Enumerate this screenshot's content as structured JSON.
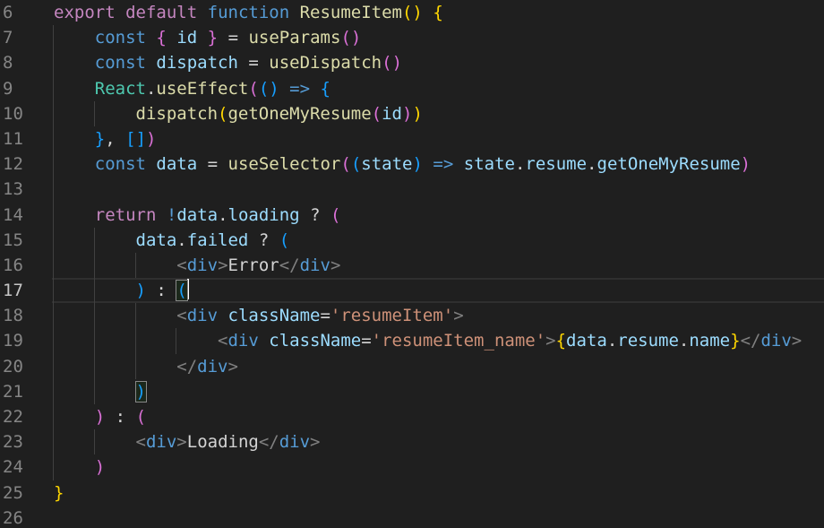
{
  "editor": {
    "background": "#1f1f1f",
    "gutter_color": "#858585",
    "gutter_active_color": "#c6c6c6",
    "guide_color": "#404040",
    "current_line": 17,
    "current_line_border": "#2f2f2f",
    "bracket_match": {
      "border": "#888888",
      "background": "rgba(0,100,0,0.13)"
    },
    "caret_color": "#ffffff",
    "token_colors": {
      "kw1": "#C586C0",
      "kw2": "#569CD6",
      "fn": "#DCDCAA",
      "cls": "#4EC9B0",
      "var": "#9CDCFE",
      "str": "#CE9178",
      "op": "#D4D4D4",
      "txt": "#D4D4D4",
      "tag": "#808080",
      "b1": "#FFD700",
      "b2": "#DA70D6",
      "b3": "#179FFF"
    },
    "lines": [
      {
        "n": 6,
        "guides": [],
        "seg": [
          [
            "kw1",
            "export"
          ],
          [
            "ws",
            " "
          ],
          [
            "kw1",
            "default"
          ],
          [
            "ws",
            " "
          ],
          [
            "kw2",
            "function"
          ],
          [
            "ws",
            " "
          ],
          [
            "fn",
            "ResumeItem"
          ],
          [
            "b1",
            "()"
          ],
          [
            "ws",
            " "
          ],
          [
            "b1",
            "{"
          ]
        ]
      },
      {
        "n": 7,
        "guides": [
          0
        ],
        "seg": [
          [
            "ws",
            "    "
          ],
          [
            "kw2",
            "const"
          ],
          [
            "ws",
            " "
          ],
          [
            "b2",
            "{"
          ],
          [
            "ws",
            " "
          ],
          [
            "var",
            "id"
          ],
          [
            "ws",
            " "
          ],
          [
            "b2",
            "}"
          ],
          [
            "ws",
            " "
          ],
          [
            "op",
            "="
          ],
          [
            "ws",
            " "
          ],
          [
            "fn",
            "useParams"
          ],
          [
            "b2",
            "()"
          ]
        ]
      },
      {
        "n": 8,
        "guides": [
          0
        ],
        "seg": [
          [
            "ws",
            "    "
          ],
          [
            "kw2",
            "const"
          ],
          [
            "ws",
            " "
          ],
          [
            "var",
            "dispatch"
          ],
          [
            "ws",
            " "
          ],
          [
            "op",
            "="
          ],
          [
            "ws",
            " "
          ],
          [
            "fn",
            "useDispatch"
          ],
          [
            "b2",
            "()"
          ]
        ]
      },
      {
        "n": 9,
        "guides": [
          0
        ],
        "seg": [
          [
            "ws",
            "    "
          ],
          [
            "cls",
            "React"
          ],
          [
            "op",
            "."
          ],
          [
            "fn",
            "useEffect"
          ],
          [
            "b2",
            "("
          ],
          [
            "b3",
            "()"
          ],
          [
            "ws",
            " "
          ],
          [
            "kw2",
            "=>"
          ],
          [
            "ws",
            " "
          ],
          [
            "b3",
            "{"
          ]
        ]
      },
      {
        "n": 10,
        "guides": [
          0,
          4
        ],
        "seg": [
          [
            "ws",
            "        "
          ],
          [
            "fn",
            "dispatch"
          ],
          [
            "b1",
            "("
          ],
          [
            "fn",
            "getOneMyResume"
          ],
          [
            "b2",
            "("
          ],
          [
            "var",
            "id"
          ],
          [
            "b2",
            ")"
          ],
          [
            "b1",
            ")"
          ]
        ]
      },
      {
        "n": 11,
        "guides": [
          0
        ],
        "seg": [
          [
            "ws",
            "    "
          ],
          [
            "b3",
            "}"
          ],
          [
            "op",
            ","
          ],
          [
            "ws",
            " "
          ],
          [
            "b3",
            "[]"
          ],
          [
            "b2",
            ")"
          ]
        ]
      },
      {
        "n": 12,
        "guides": [
          0
        ],
        "seg": [
          [
            "ws",
            "    "
          ],
          [
            "kw2",
            "const"
          ],
          [
            "ws",
            " "
          ],
          [
            "var",
            "data"
          ],
          [
            "ws",
            " "
          ],
          [
            "op",
            "="
          ],
          [
            "ws",
            " "
          ],
          [
            "fn",
            "useSelector"
          ],
          [
            "b2",
            "("
          ],
          [
            "b3",
            "("
          ],
          [
            "var",
            "state"
          ],
          [
            "b3",
            ")"
          ],
          [
            "ws",
            " "
          ],
          [
            "kw2",
            "=>"
          ],
          [
            "ws",
            " "
          ],
          [
            "var",
            "state"
          ],
          [
            "op",
            "."
          ],
          [
            "var",
            "resume"
          ],
          [
            "op",
            "."
          ],
          [
            "var",
            "getOneMyResume"
          ],
          [
            "b2",
            ")"
          ]
        ]
      },
      {
        "n": 13,
        "guides": [
          0
        ],
        "seg": []
      },
      {
        "n": 14,
        "guides": [
          0
        ],
        "seg": [
          [
            "ws",
            "    "
          ],
          [
            "kw1",
            "return"
          ],
          [
            "ws",
            " "
          ],
          [
            "kw2",
            "!"
          ],
          [
            "var",
            "data"
          ],
          [
            "op",
            "."
          ],
          [
            "var",
            "loading"
          ],
          [
            "ws",
            " "
          ],
          [
            "op",
            "?"
          ],
          [
            "ws",
            " "
          ],
          [
            "b2",
            "("
          ]
        ]
      },
      {
        "n": 15,
        "guides": [
          0,
          4
        ],
        "seg": [
          [
            "ws",
            "        "
          ],
          [
            "var",
            "data"
          ],
          [
            "op",
            "."
          ],
          [
            "var",
            "failed"
          ],
          [
            "ws",
            " "
          ],
          [
            "op",
            "?"
          ],
          [
            "ws",
            " "
          ],
          [
            "b3",
            "("
          ]
        ]
      },
      {
        "n": 16,
        "guides": [
          0,
          4,
          8
        ],
        "seg": [
          [
            "ws",
            "            "
          ],
          [
            "tag",
            "<"
          ],
          [
            "kw2",
            "div"
          ],
          [
            "tag",
            ">"
          ],
          [
            "txt",
            "Error"
          ],
          [
            "tag",
            "</"
          ],
          [
            "kw2",
            "div"
          ],
          [
            "tag",
            ">"
          ]
        ]
      },
      {
        "n": 17,
        "guides": [
          0,
          4
        ],
        "current": true,
        "seg": [
          [
            "ws",
            "        "
          ],
          [
            "b3",
            ")"
          ],
          [
            "ws",
            " "
          ],
          [
            "op",
            ":"
          ],
          [
            "ws",
            " "
          ],
          [
            "b3",
            "(",
            "match"
          ],
          [
            "caret",
            ""
          ]
        ]
      },
      {
        "n": 18,
        "guides": [
          0,
          4,
          8
        ],
        "seg": [
          [
            "ws",
            "            "
          ],
          [
            "tag",
            "<"
          ],
          [
            "kw2",
            "div"
          ],
          [
            "ws",
            " "
          ],
          [
            "var",
            "className"
          ],
          [
            "op",
            "="
          ],
          [
            "str",
            "'resumeItem'"
          ],
          [
            "tag",
            ">"
          ]
        ]
      },
      {
        "n": 19,
        "guides": [
          0,
          4,
          8,
          12
        ],
        "seg": [
          [
            "ws",
            "                "
          ],
          [
            "tag",
            "<"
          ],
          [
            "kw2",
            "div"
          ],
          [
            "ws",
            " "
          ],
          [
            "var",
            "className"
          ],
          [
            "op",
            "="
          ],
          [
            "str",
            "'resumeItem_name'"
          ],
          [
            "tag",
            ">"
          ],
          [
            "b1",
            "{"
          ],
          [
            "var",
            "data"
          ],
          [
            "op",
            "."
          ],
          [
            "var",
            "resume"
          ],
          [
            "op",
            "."
          ],
          [
            "var",
            "name"
          ],
          [
            "b1",
            "}"
          ],
          [
            "tag",
            "</"
          ],
          [
            "kw2",
            "div"
          ],
          [
            "tag",
            ">"
          ]
        ]
      },
      {
        "n": 20,
        "guides": [
          0,
          4,
          8
        ],
        "seg": [
          [
            "ws",
            "            "
          ],
          [
            "tag",
            "</"
          ],
          [
            "kw2",
            "div"
          ],
          [
            "tag",
            ">"
          ]
        ]
      },
      {
        "n": 21,
        "guides": [
          0,
          4
        ],
        "seg": [
          [
            "ws",
            "        "
          ],
          [
            "b3",
            ")",
            "match"
          ]
        ]
      },
      {
        "n": 22,
        "guides": [
          0
        ],
        "seg": [
          [
            "ws",
            "    "
          ],
          [
            "b2",
            ")"
          ],
          [
            "ws",
            " "
          ],
          [
            "op",
            ":"
          ],
          [
            "ws",
            " "
          ],
          [
            "b2",
            "("
          ]
        ]
      },
      {
        "n": 23,
        "guides": [
          0,
          4
        ],
        "seg": [
          [
            "ws",
            "        "
          ],
          [
            "tag",
            "<"
          ],
          [
            "kw2",
            "div"
          ],
          [
            "tag",
            ">"
          ],
          [
            "txt",
            "Loading"
          ],
          [
            "tag",
            "</"
          ],
          [
            "kw2",
            "div"
          ],
          [
            "tag",
            ">"
          ]
        ]
      },
      {
        "n": 24,
        "guides": [
          0
        ],
        "seg": [
          [
            "ws",
            "    "
          ],
          [
            "b2",
            ")"
          ]
        ]
      },
      {
        "n": 25,
        "guides": [],
        "seg": [
          [
            "b1",
            "}"
          ]
        ]
      },
      {
        "n": 26,
        "guides": [],
        "seg": []
      }
    ]
  }
}
